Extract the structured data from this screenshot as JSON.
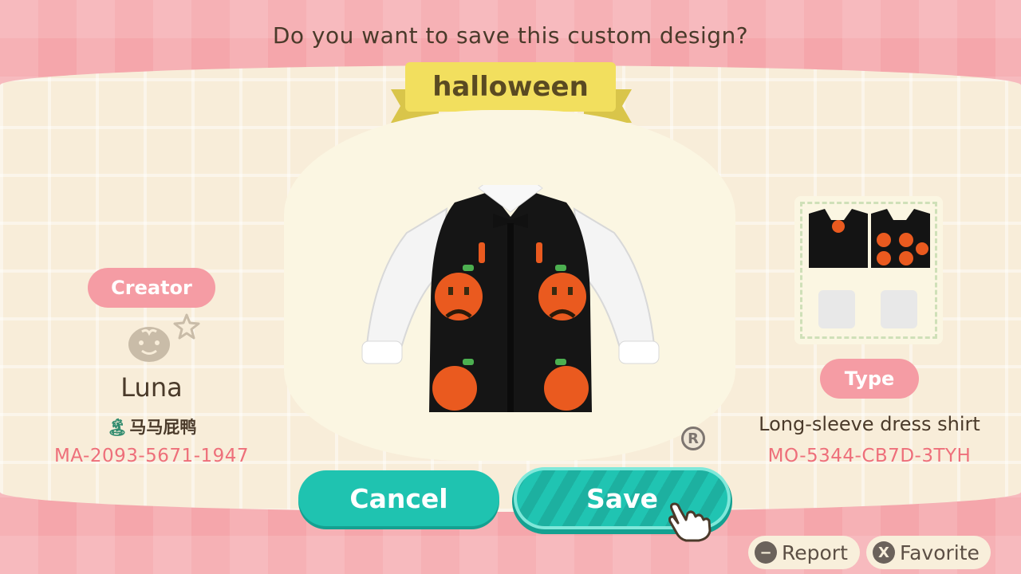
{
  "dialog": {
    "question": "Do you want to save this custom design?",
    "design_name": "halloween"
  },
  "creator": {
    "label": "Creator",
    "name": "Luna",
    "island": "马马屁鸭",
    "creator_code": "MA-2093-5671-1947"
  },
  "design": {
    "type_label": "Type",
    "type_value": "Long-sleeve dress shirt",
    "design_code": "MO-5344-CB7D-3TYH"
  },
  "buttons": {
    "cancel": "Cancel",
    "save": "Save"
  },
  "hints": {
    "report_glyph": "−",
    "report": "Report",
    "favorite_glyph": "X",
    "favorite": "Favorite"
  },
  "colors": {
    "background_pink": "#f5a6ab",
    "accent_teal": "#20c4b2",
    "code_pink": "#ee6f7a",
    "ribbon_yellow": "#f2df5e"
  }
}
